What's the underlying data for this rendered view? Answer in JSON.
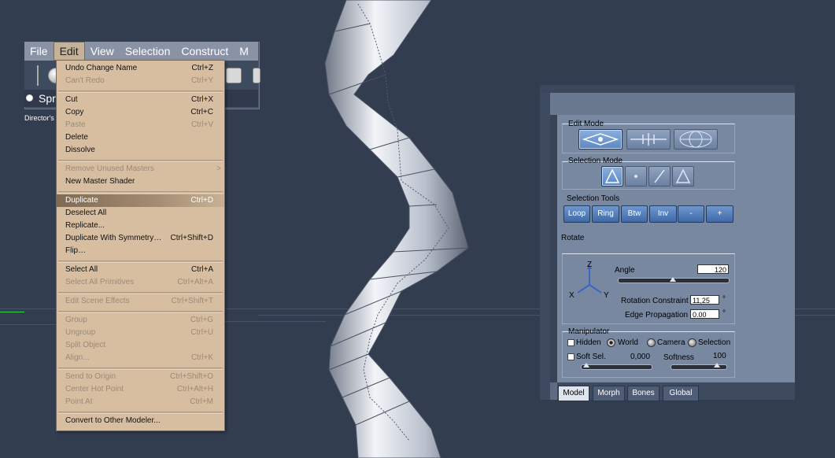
{
  "menubar": {
    "items": [
      "File",
      "Edit",
      "View",
      "Selection",
      "Construct",
      "M"
    ],
    "active": "Edit"
  },
  "scene_tab": {
    "label": "Spr"
  },
  "director_label": "Director's",
  "edit_menu": {
    "items": [
      {
        "label": "Undo Change Name",
        "shortcut": "Ctrl+Z",
        "disabled": false
      },
      {
        "label": "Can't Redo",
        "shortcut": "Ctrl+Y",
        "disabled": true
      },
      {
        "label": "Cut",
        "shortcut": "Ctrl+X",
        "disabled": false
      },
      {
        "label": "Copy",
        "shortcut": "Ctrl+C",
        "disabled": false
      },
      {
        "label": "Paste",
        "shortcut": "Ctrl+V",
        "disabled": true
      },
      {
        "label": "Delete",
        "shortcut": "",
        "disabled": false
      },
      {
        "label": "Dissolve",
        "shortcut": "",
        "disabled": false
      },
      {
        "label": "Remove Unused Masters",
        "shortcut": ">",
        "disabled": true
      },
      {
        "label": "New Master Shader",
        "shortcut": "",
        "disabled": false
      },
      {
        "label": "Duplicate",
        "shortcut": "Ctrl+D",
        "disabled": false,
        "highlighted": true
      },
      {
        "label": "Deselect All",
        "shortcut": "",
        "disabled": false
      },
      {
        "label": "Replicate...",
        "shortcut": "",
        "disabled": false
      },
      {
        "label": "Duplicate With Symmetry…",
        "shortcut": "Ctrl+Shift+D",
        "disabled": false
      },
      {
        "label": "Flip…",
        "shortcut": "",
        "disabled": false
      },
      {
        "label": "Select All",
        "shortcut": "Ctrl+A",
        "disabled": false
      },
      {
        "label": "Select All Primitives",
        "shortcut": "Ctrl+Alt+A",
        "disabled": true
      },
      {
        "label": "Edit Scene Effects",
        "shortcut": "Ctrl+Shift+T",
        "disabled": true
      },
      {
        "label": "Group",
        "shortcut": "Ctrl+G",
        "disabled": true
      },
      {
        "label": "Ungroup",
        "shortcut": "Ctrl+U",
        "disabled": true
      },
      {
        "label": "Split Object",
        "shortcut": "",
        "disabled": true
      },
      {
        "label": "Align...",
        "shortcut": "Ctrl+K",
        "disabled": true
      },
      {
        "label": "Send to Origin",
        "shortcut": "Ctrl+Shift+O",
        "disabled": true
      },
      {
        "label": "Center Hot Point",
        "shortcut": "Ctrl+Alt+H",
        "disabled": true
      },
      {
        "label": "Point At",
        "shortcut": "Ctrl+M",
        "disabled": true
      },
      {
        "label": "Convert to Other Modeler...",
        "shortcut": "",
        "disabled": false
      }
    ]
  },
  "panel": {
    "edit_mode_title": "Edit Mode",
    "selection_mode_title": "Selection Mode",
    "selection_tools_title": "Selection Tools",
    "selection_tools": [
      "Loop",
      "Ring",
      "Btw",
      "Inv",
      "-",
      "+"
    ],
    "rotate_label": "Rotate",
    "axis": {
      "z": "Z",
      "x": "X",
      "y": "Y"
    },
    "angle_label": "Angle",
    "angle_value": "120",
    "angle_slider": 0.5,
    "rotation_constraint_label": "Rotation Constraint",
    "rotation_constraint_value": "11,25",
    "edge_propagation_label": "Edge Propagation",
    "edge_propagation_value": "0.00",
    "degree_symbol": "°",
    "manipulator_title": "Manipulator",
    "hidden_label": "Hidden",
    "world_label": "World",
    "camera_label": "Camera",
    "selection_label": "Selection",
    "soft_sel_label": "Soft Sel.",
    "soft_sel_value": "0,000",
    "softness_label": "Softness",
    "softness_value": "100",
    "tabs": [
      "Model",
      "Morph",
      "Bones",
      "Global"
    ],
    "active_tab": "Model"
  },
  "colors": {
    "viewport_bg": "#333d50",
    "menu_bg": "#d7bea0",
    "menu_highlight": "#7f6a52",
    "panel_bg": "#7888a1",
    "active_button": "#5d86c2"
  }
}
